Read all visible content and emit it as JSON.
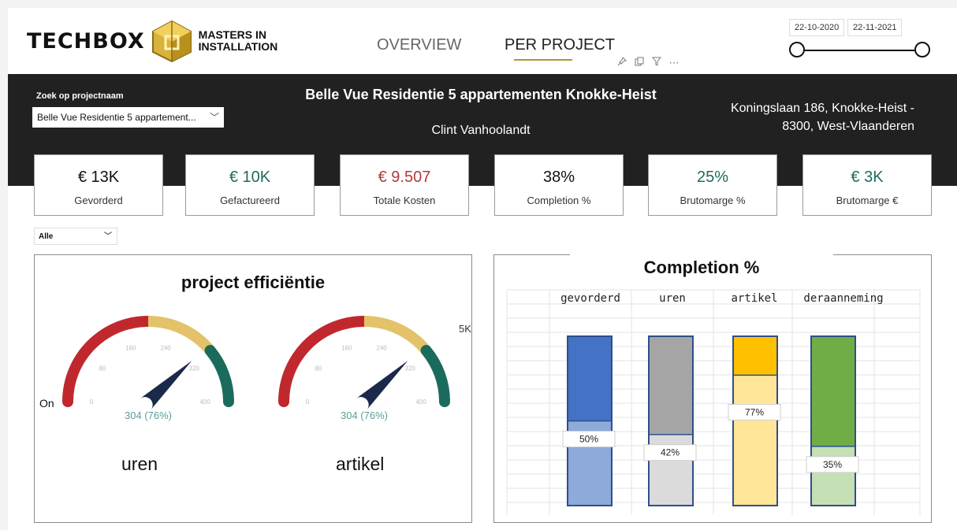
{
  "logo": {
    "word": "TECHBOX",
    "tagline_1": "MASTERS IN",
    "tagline_2": "INSTALLATION"
  },
  "nav": {
    "tabs": [
      {
        "label": "OVERVIEW"
      },
      {
        "label": "PER PROJECT",
        "active": true
      }
    ]
  },
  "visual_tools": {
    "icons": [
      "pin-icon",
      "copy-icon",
      "filter-icon",
      "more-options-icon"
    ],
    "more_label": "⋯"
  },
  "date_range": {
    "start": "22-10-2020",
    "end": "22-11-2021"
  },
  "search": {
    "label": "Zoek op projectnaam",
    "selected": "Belle Vue Residentie 5 appartement..."
  },
  "project": {
    "title": "Belle Vue Residentie 5 appartementen Knokke-Heist",
    "person": "Clint Vanhoolandt",
    "address_1": "Koningslaan 186, Knokke-Heist -",
    "address_2": "8300, West-Vlaanderen"
  },
  "kpis": [
    {
      "value": "€ 13K",
      "label": "Gevorderd",
      "color": "#111111"
    },
    {
      "value": "€ 10K",
      "label": "Gefactureerd",
      "color": "#1f6b5e"
    },
    {
      "value": "€ 9.507",
      "label": "Totale Kosten",
      "color": "#b03a3a"
    },
    {
      "value": "38%",
      "label": "Completion %",
      "color": "#111111"
    },
    {
      "value": "25%",
      "label": "Brutomarge %",
      "color": "#1f6b5e"
    },
    {
      "value": "€ 3K",
      "label": "Brutomarge €",
      "color": "#1f6b5e"
    }
  ],
  "filter": {
    "selected": "Alle"
  },
  "left_panel": {
    "title": "project efficiëntie",
    "side_label": "On",
    "fragment_label": "5K",
    "gauges": [
      {
        "caption": "uren",
        "readout": "304 (76%)",
        "value": 304,
        "max": 400,
        "ticks": [
          "0",
          "80",
          "160",
          "240",
          "320",
          "400"
        ]
      },
      {
        "caption": "artikel",
        "readout": "304 (76%)",
        "value": 304,
        "max": 400,
        "ticks": [
          "0",
          "80",
          "160",
          "240",
          "320",
          "400"
        ]
      }
    ],
    "colors": {
      "red": "#c0282d",
      "yellow": "#e3c26a",
      "green": "#1b6b5d",
      "needle": "#1b2a4a",
      "readout": "#5a9e9a"
    }
  },
  "chart_data": {
    "type": "bar",
    "title": "Completion %",
    "categories": [
      "gevorderd",
      "uren",
      "artikel",
      "deraanneming"
    ],
    "ylim": [
      0,
      100
    ],
    "values": [
      50,
      42,
      77,
      35
    ],
    "value_labels": [
      "50%",
      "42%",
      "77%",
      "35%"
    ],
    "colors": {
      "full": [
        "#4472c4",
        "#a5a5a5",
        "#ffc000",
        "#70ad47"
      ],
      "fill": [
        "#8eaadb",
        "#dbdbdb",
        "#ffe699",
        "#c5e0b4"
      ],
      "border": "#2f4f8a"
    },
    "grid": true
  }
}
